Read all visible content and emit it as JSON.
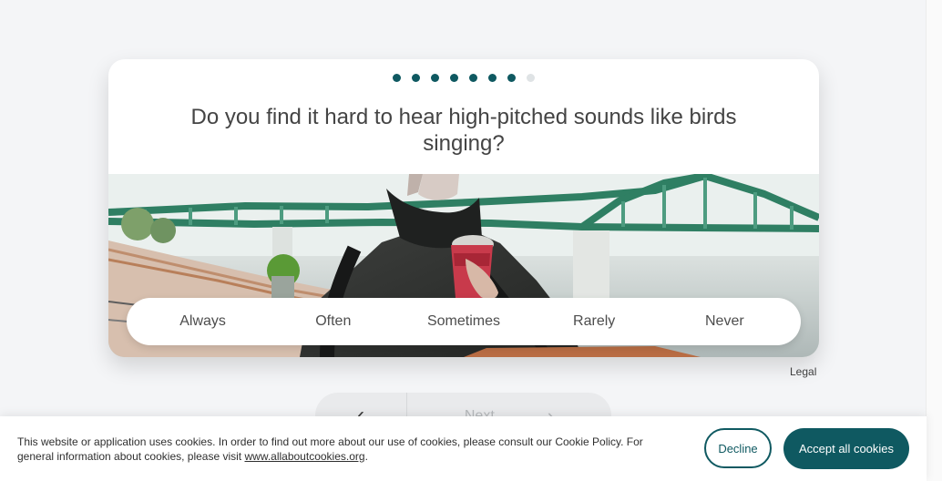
{
  "survey": {
    "progress": {
      "total": 8,
      "completed": 7
    },
    "question": "Do you find it hard to hear high-pitched sounds like birds singing?",
    "answers": [
      "Always",
      "Often",
      "Sometimes",
      "Rarely",
      "Never"
    ]
  },
  "legal": {
    "label": "Legal"
  },
  "navigation": {
    "back_icon": "chevron-left-icon",
    "next_label": "Next",
    "next_icon": "chevron-right-icon"
  },
  "cookie_banner": {
    "text_part1": "This website or application uses cookies. In order to find out more about our use of cookies, please consult our Cookie Policy. For general information about cookies, please visit ",
    "link": "www.allaboutcookies.org",
    "text_part2": ".",
    "decline_label": "Decline",
    "accept_label": "Accept all cookies"
  },
  "colors": {
    "accent": "#0f5961",
    "progress_inactive": "#dfe3e5",
    "page_background": "#f4f5f7"
  }
}
